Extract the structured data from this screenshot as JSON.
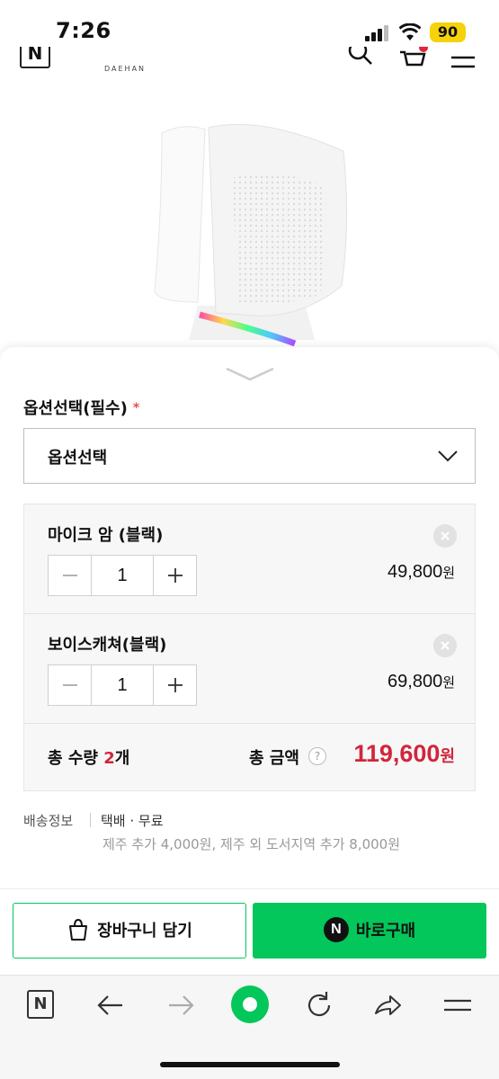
{
  "status_bar": {
    "time": "7:26",
    "battery": "90"
  },
  "header": {
    "logo_letter": "N",
    "brand": "DAEHAN"
  },
  "option": {
    "label": "옵션선택(필수)",
    "required_mark": "*",
    "select_value": "옵션선택"
  },
  "items": [
    {
      "name": "마이크 암 (블랙)",
      "qty": "1",
      "price": "49,800",
      "currency": "원"
    },
    {
      "name": "보이스캐쳐(블랙)",
      "qty": "1",
      "price": "69,800",
      "currency": "원"
    }
  ],
  "total": {
    "qty_label": "총 수량",
    "qty": "2",
    "qty_unit": "개",
    "amount_label": "총 금액",
    "help": "?",
    "amount": "119,600",
    "currency": "원"
  },
  "shipping": {
    "label": "배송정보",
    "value": "택배 · 무료",
    "extra": "제주 추가 4,000원, 제주 외 도서지역 추가 8,000원"
  },
  "buttons": {
    "cart": "장바구니 담기",
    "buy": "바로구매",
    "npay_letter": "N"
  },
  "toolbar": {
    "n_letter": "N"
  },
  "colors": {
    "accent_green": "#03c75a",
    "price_red": "#d0263c"
  }
}
